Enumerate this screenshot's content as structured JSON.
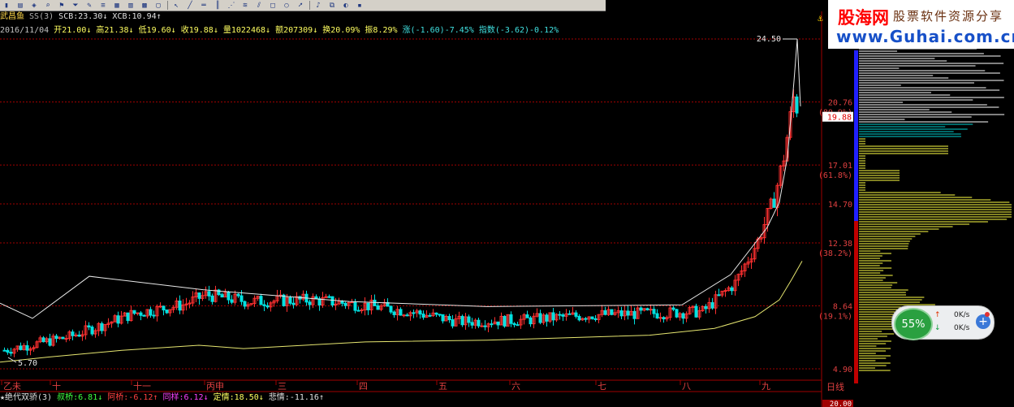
{
  "toolbar": {
    "icons": [
      "chart-icon",
      "stock-icon",
      "cube-icon",
      "magnifier-icon",
      "flag-icon",
      "funnel-icon",
      "pencil-icon",
      "list-icon",
      "table-icon",
      "grid-icon",
      "calc-icon",
      "window-icon",
      "cursor-icon",
      "line-icon",
      "hline-icon",
      "vline-icon",
      "fan-icon",
      "fib-icon",
      "channel-icon",
      "rect-icon",
      "ellipse-icon",
      "arrow-icon",
      "bell-icon",
      "copy-icon",
      "palette-icon",
      "save-icon"
    ]
  },
  "stock": {
    "name": "武昌鱼",
    "ss": "SS(3)",
    "scb": "SCB:23.30↓",
    "xcb": "XCB:10.94↑"
  },
  "quote": {
    "date": "2016/11/04",
    "open": "开21.00↓",
    "high": "高21.38↓",
    "low": "低19.60↓",
    "close": "收19.88↓",
    "volume": "量1022468↓",
    "amount": "额207309↓",
    "turnover": "换20.09%",
    "amplitude": "振8.29%",
    "change": "涨(-1.60)-7.45%",
    "index": "指数(-3.62)-0.12%"
  },
  "price_axis": {
    "labels": [
      "24.50",
      "20.76",
      "(80.9%)",
      "17.01",
      "(61.8%)",
      "14.70",
      "12.38",
      "(38.2%)",
      "8.64",
      "(19.1%)",
      "4.90"
    ],
    "current_price": "19.88",
    "top_price_label": "24.50",
    "low_price_label": "5.70"
  },
  "time_axis": {
    "labels": [
      "乙未",
      "十",
      "十一",
      "丙申",
      "三",
      "四",
      "五",
      "六",
      "七",
      "八",
      "九"
    ],
    "period_label": "日线"
  },
  "indicator": {
    "name": "★绝代双骄(3)",
    "v1": "叔桥:6.81↓",
    "v2": "阿桥:-6.12↑",
    "v3": "同样:6.12↓",
    "v4": "定情:18.50↓",
    "v5": "悲情:-11.16↑",
    "axis_value": "20.00"
  },
  "logo": {
    "brand": "股海网",
    "slogan": "股票软件资源分享",
    "url": "www.Guhai.com.cn"
  },
  "widget": {
    "percent": "55%",
    "up_rate": "0K/s",
    "down_rate": "0K/s"
  },
  "colors": {
    "up": "#ff3030",
    "down": "#00e0e0",
    "grid": "#a00000",
    "ma_white": "#e8e8e8",
    "ma_yellow": "#e6e670",
    "chip_yellow": "#ffff44",
    "chip_cyan": "#00d0d0"
  }
}
